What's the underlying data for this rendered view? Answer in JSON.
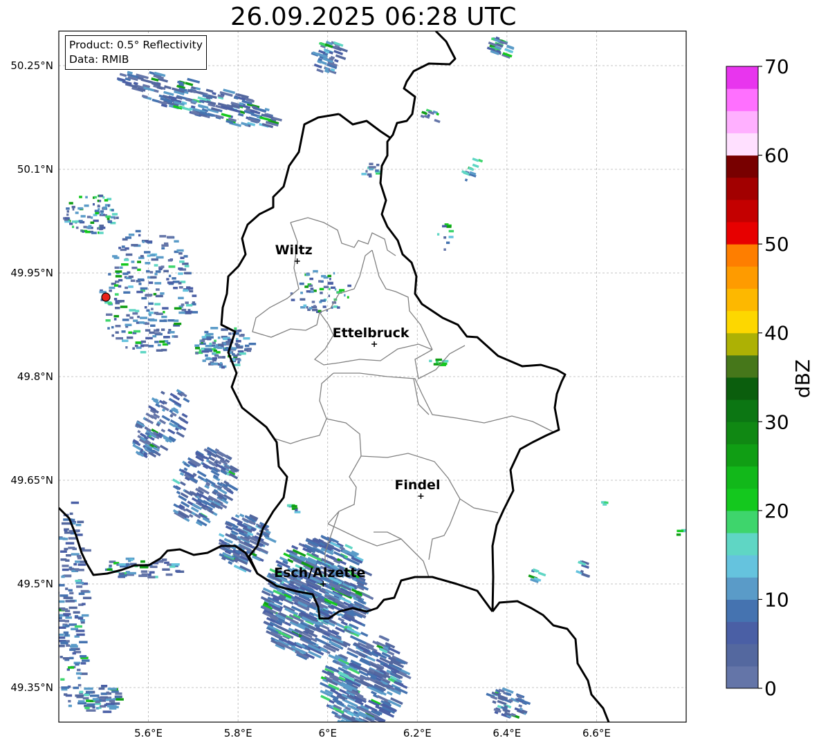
{
  "title": "26.09.2025 06:28 UTC",
  "info": {
    "product": "Product: 0.5° Reflectivity",
    "source": "Data: RMIB"
  },
  "map": {
    "extent": {
      "lon": [
        5.4,
        6.8
      ],
      "lat": [
        49.3,
        50.3
      ]
    },
    "lat_ticks": [
      {
        "value": 50.25,
        "label": "50.25°N"
      },
      {
        "value": 50.1,
        "label": "50.1°N"
      },
      {
        "value": 49.95,
        "label": "49.95°N"
      },
      {
        "value": 49.8,
        "label": "49.8°N"
      },
      {
        "value": 49.65,
        "label": "49.65°N"
      },
      {
        "value": 49.5,
        "label": "49.5°N"
      },
      {
        "value": 49.35,
        "label": "49.35°N"
      }
    ],
    "lon_ticks": [
      {
        "value": 5.6,
        "label": "5.6°E"
      },
      {
        "value": 5.8,
        "label": "5.8°E"
      },
      {
        "value": 6.0,
        "label": "6°E"
      },
      {
        "value": 6.2,
        "label": "6.2°E"
      },
      {
        "value": 6.4,
        "label": "6.4°E"
      },
      {
        "value": 6.6,
        "label": "6.6°E"
      }
    ],
    "grid": true,
    "radar_site": {
      "lon": 5.505,
      "lat": 49.915,
      "color": "#e8201a"
    },
    "cities": [
      {
        "name": "Wiltz",
        "lon": 5.932,
        "lat": 49.967
      },
      {
        "name": "Ettelbruck",
        "lon": 6.104,
        "lat": 49.847
      },
      {
        "name": "Findel",
        "lon": 6.208,
        "lat": 49.627
      },
      {
        "name": "Esch/Alzette",
        "lon": 5.99,
        "lat": 49.5
      }
    ]
  },
  "colorbar": {
    "label": "dBZ",
    "min": 0,
    "max": 70,
    "ticks": [
      0,
      10,
      20,
      30,
      40,
      50,
      60,
      70
    ],
    "colors": [
      "#6475a8",
      "#54689f",
      "#4a5fa5",
      "#4573b0",
      "#5a9bc8",
      "#65c3de",
      "#5fd6c4",
      "#3ed56c",
      "#14c81e",
      "#12b81a",
      "#109e14",
      "#108813",
      "#0c7613",
      "#0b5e0d",
      "#46771a",
      "#adb104",
      "#fdd700",
      "#fdb800",
      "#fe9b00",
      "#fe7e00",
      "#e70000",
      "#c40000",
      "#a20000",
      "#780000",
      "#ffe0ff",
      "#ffb0ff",
      "#ff70ff",
      "#e835ee"
    ]
  }
}
